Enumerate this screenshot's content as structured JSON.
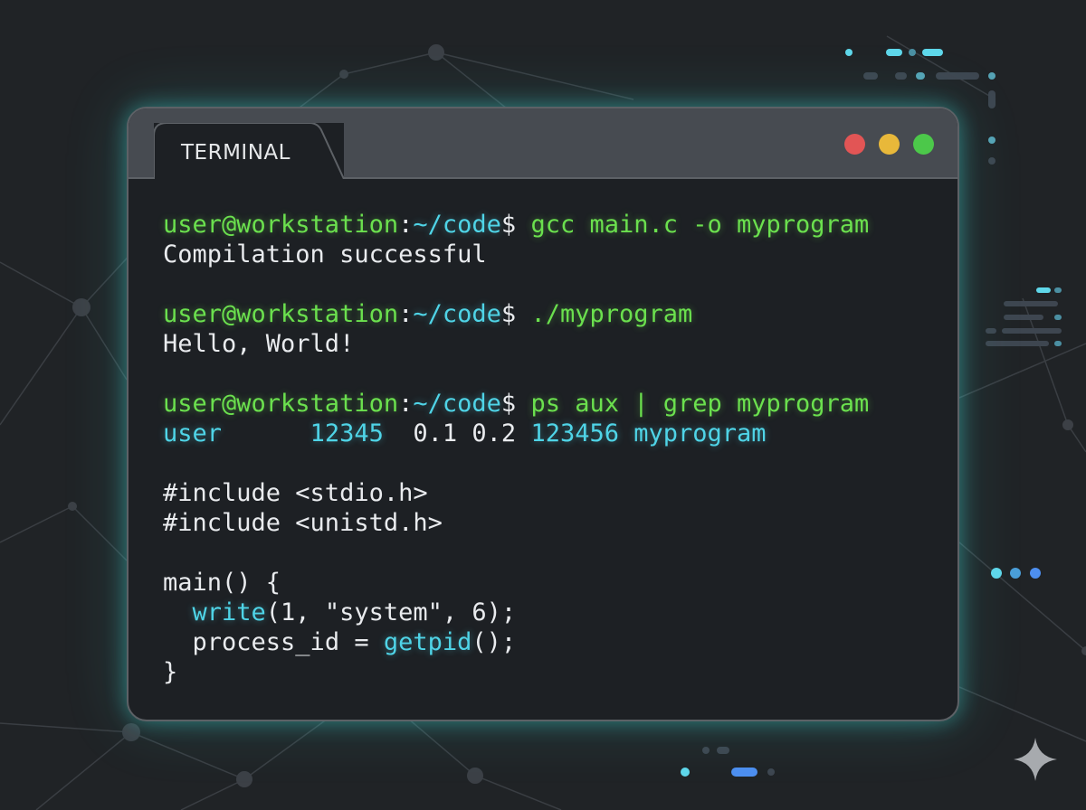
{
  "window": {
    "tab_label": "TERMINAL",
    "controls": [
      {
        "name": "close",
        "color": "#e25555"
      },
      {
        "name": "minimize",
        "color": "#e8b83a"
      },
      {
        "name": "maximize",
        "color": "#4cc84a"
      }
    ]
  },
  "colors": {
    "prompt": "#6be04e",
    "path": "#4fd4e7",
    "text": "#e9ebee",
    "glow": "#40e1dc",
    "window_frame": "#5d6166"
  },
  "terminal": {
    "prompt_user": "user@workstation",
    "prompt_separator": ":",
    "prompt_path": "~/code",
    "prompt_symbol": "$",
    "cmd1": "gcc main.c -o myprogram",
    "out1": "Compilation successful",
    "cmd2": "./myprogram",
    "out2": "Hello, World!",
    "cmd3": "ps aux | grep myprogram",
    "ps_user": "user",
    "ps_pid": "12345",
    "ps_cpu_mem": "0.1 0.2",
    "ps_vsz": "123456",
    "ps_command": "myprogram",
    "code_include1": "#include <stdio.h>",
    "code_include2": "#include <unistd.h>",
    "code_main": "main() {",
    "code_write_fn": "write",
    "code_write_args": "(1, \"system\", 6);",
    "code_assign": "process_id = ",
    "code_getpid_fn": "getpid",
    "code_getpid_end": "();",
    "code_close": "}"
  },
  "icons": [
    "sparkle-icon"
  ]
}
